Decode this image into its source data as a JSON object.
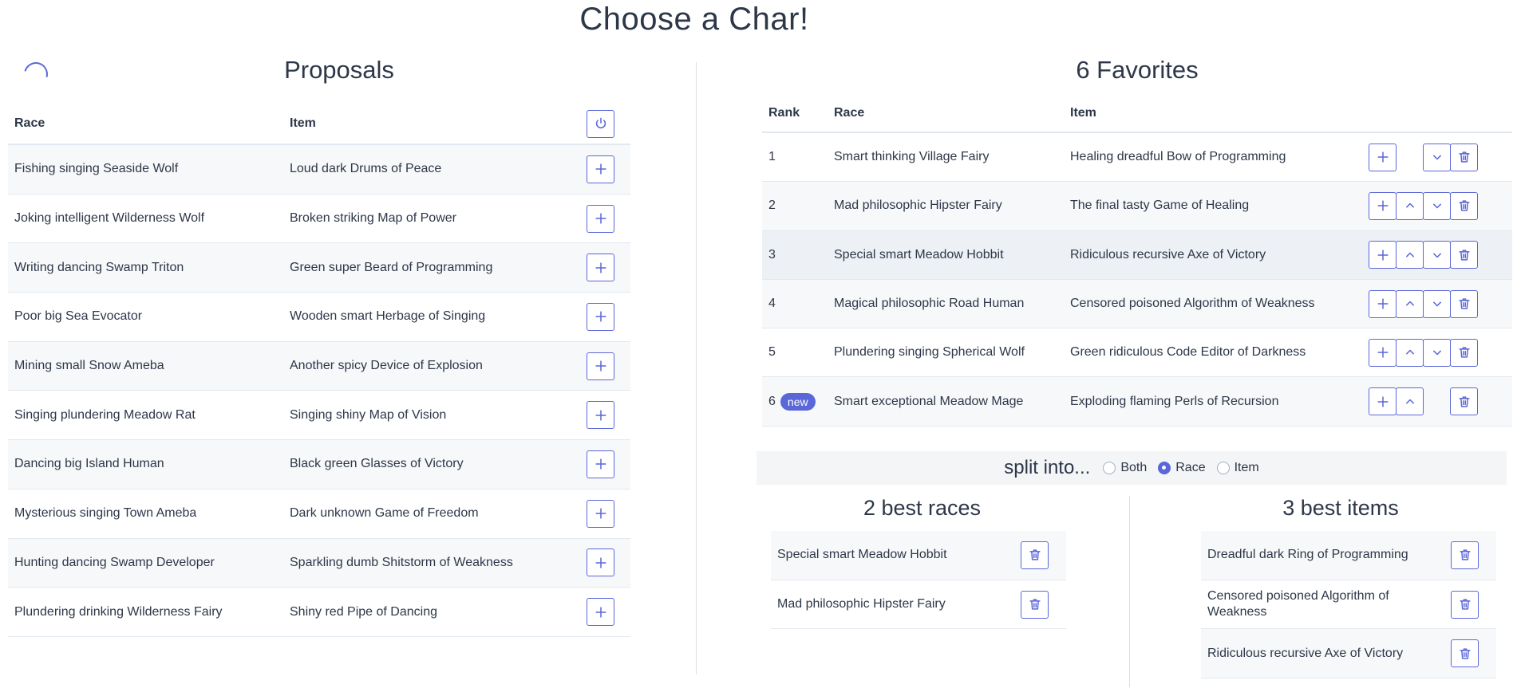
{
  "page_title": "Choose a Char!",
  "proposals": {
    "title": "Proposals",
    "headers": {
      "race": "Race",
      "item": "Item"
    },
    "rows": [
      {
        "race": "Fishing singing Seaside Wolf",
        "item": "Loud dark Drums of Peace"
      },
      {
        "race": "Joking intelligent Wilderness Wolf",
        "item": "Broken striking Map of Power"
      },
      {
        "race": "Writing dancing Swamp Triton",
        "item": "Green super Beard of Programming"
      },
      {
        "race": "Poor big Sea Evocator",
        "item": "Wooden smart Herbage of Singing"
      },
      {
        "race": "Mining small Snow Ameba",
        "item": "Another spicy Device of Explosion"
      },
      {
        "race": "Singing plundering Meadow Rat",
        "item": "Singing shiny Map of Vision"
      },
      {
        "race": "Dancing big Island Human",
        "item": "Black green Glasses of Victory"
      },
      {
        "race": "Mysterious singing Town Ameba",
        "item": "Dark unknown Game of Freedom"
      },
      {
        "race": "Hunting dancing Swamp Developer",
        "item": "Sparkling dumb Shitstorm of Weakness"
      },
      {
        "race": "Plundering drinking Wilderness Fairy",
        "item": "Shiny red Pipe of Dancing"
      }
    ]
  },
  "favorites": {
    "title": "6 Favorites",
    "headers": {
      "rank": "Rank",
      "race": "Race",
      "item": "Item"
    },
    "rows": [
      {
        "rank": "1",
        "badge": "",
        "race": "Smart thinking Village Fairy",
        "item": "Healing dreadful Bow of Programming"
      },
      {
        "rank": "2",
        "badge": "",
        "race": "Mad philosophic Hipster Fairy",
        "item": "The final tasty Game of Healing"
      },
      {
        "rank": "3",
        "badge": "",
        "race": "Special smart Meadow Hobbit",
        "item": "Ridiculous recursive Axe of Victory"
      },
      {
        "rank": "4",
        "badge": "",
        "race": "Magical philosophic Road Human",
        "item": "Censored poisoned Algorithm of Weakness"
      },
      {
        "rank": "5",
        "badge": "",
        "race": "Plundering singing Spherical Wolf",
        "item": "Green ridiculous Code Editor of Darkness"
      },
      {
        "rank": "6",
        "badge": "new",
        "race": "Smart exceptional Meadow Mage",
        "item": "Exploding flaming Perls of Recursion"
      }
    ]
  },
  "split": {
    "label": "split into...",
    "options": [
      "Both",
      "Race",
      "Item"
    ],
    "selected": "Race"
  },
  "best_races": {
    "title": "2 best races",
    "items": [
      "Special smart Meadow Hobbit",
      "Mad philosophic Hipster Fairy"
    ]
  },
  "best_items": {
    "title": "3 best items",
    "items": [
      "Dreadful dark Ring of Programming",
      "Censored poisoned Algorithm of Weakness",
      "Ridiculous recursive Axe of Victory"
    ]
  },
  "colors": {
    "accent": "#5a67d8",
    "text": "#2d3748",
    "stripe": "#f7f8fa",
    "border": "#e2e8f0"
  }
}
